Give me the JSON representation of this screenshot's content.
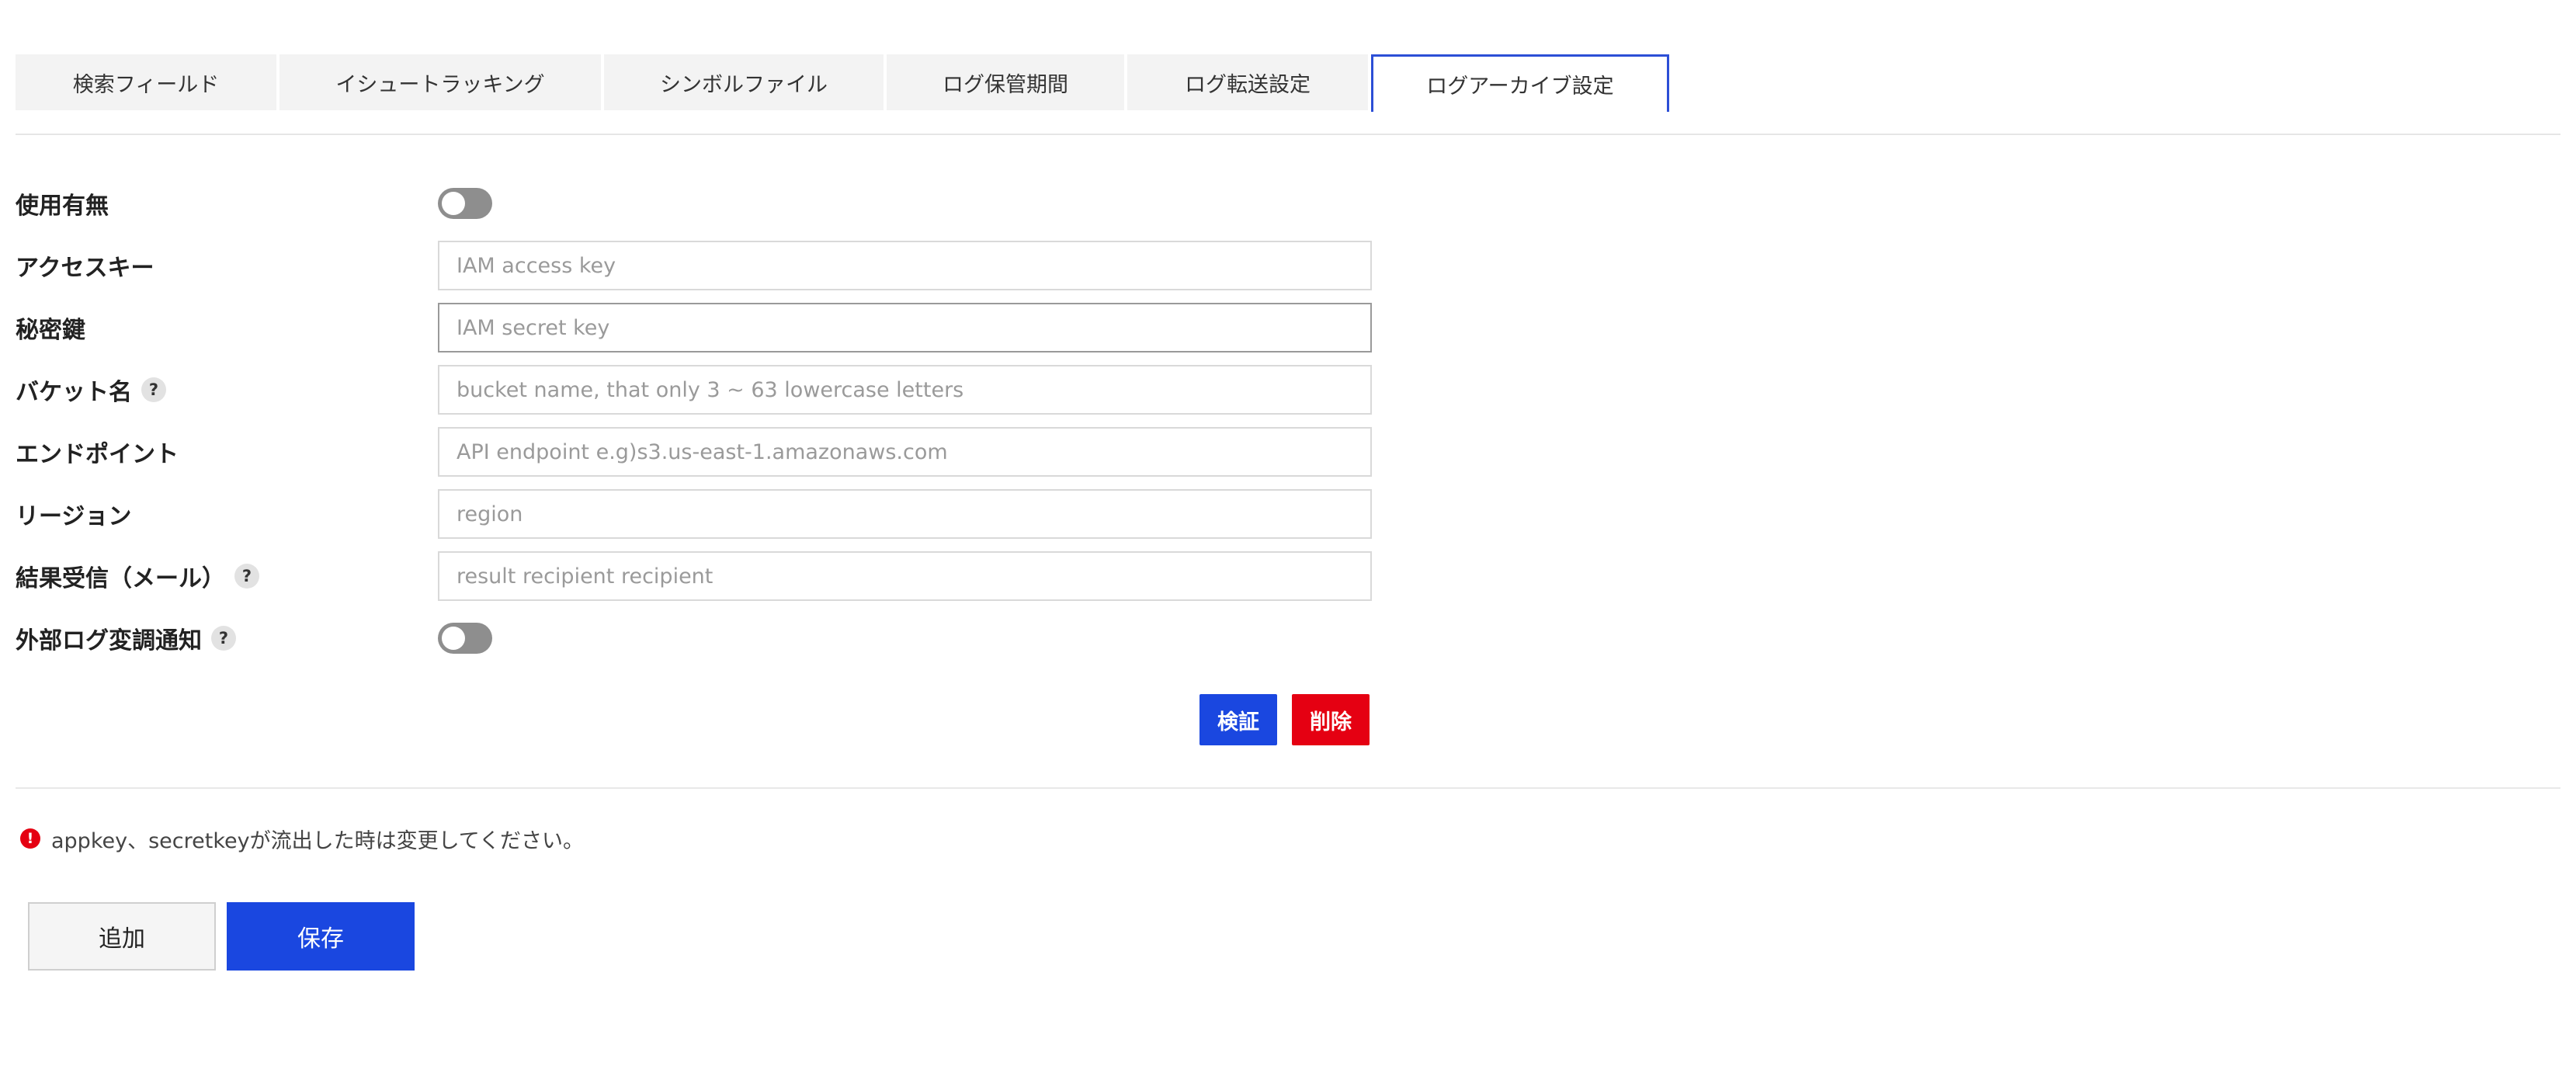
{
  "tabs": [
    {
      "label": "検索フィールド"
    },
    {
      "label": "イシュートラッキング"
    },
    {
      "label": "シンボルファイル"
    },
    {
      "label": "ログ保管期間"
    },
    {
      "label": "ログ転送設定"
    },
    {
      "label": "ログアーカイブ設定"
    }
  ],
  "active_tab": "ログアーカイブ設定",
  "form": {
    "enabled": {
      "label": "使用有無",
      "on": false
    },
    "access_key": {
      "label": "アクセスキー",
      "placeholder": "IAM access key",
      "value": ""
    },
    "secret_key": {
      "label": "秘密鍵",
      "placeholder": "IAM secret key",
      "value": ""
    },
    "bucket": {
      "label": "バケット名",
      "placeholder": "bucket name, that only 3 ~ 63 lowercase letters",
      "value": ""
    },
    "endpoint": {
      "label": "エンドポイント",
      "placeholder": "API endpoint e.g)s3.us-east-1.amazonaws.com",
      "value": ""
    },
    "region": {
      "label": "リージョン",
      "placeholder": "region",
      "value": ""
    },
    "result_recipient": {
      "label": "結果受信（メール）",
      "placeholder": "result recipient recipient",
      "value": ""
    },
    "external_log_notify": {
      "label": "外部ログ変調通知",
      "on": false
    }
  },
  "help_glyph": "?",
  "buttons": {
    "verify": "検証",
    "delete": "削除",
    "add": "追加",
    "save": "保存"
  },
  "notice": {
    "icon_glyph": "!",
    "text": "appkey、secretkeyが流出した時は変更してください。"
  },
  "colors": {
    "primary": "#1a47e0",
    "danger": "#e50012",
    "tab_active_border": "#2c4fd6",
    "toggle_off": "#8e8e8e"
  },
  "icons": {
    "help": "question-circle-icon",
    "warning": "exclamation-circle-icon"
  }
}
